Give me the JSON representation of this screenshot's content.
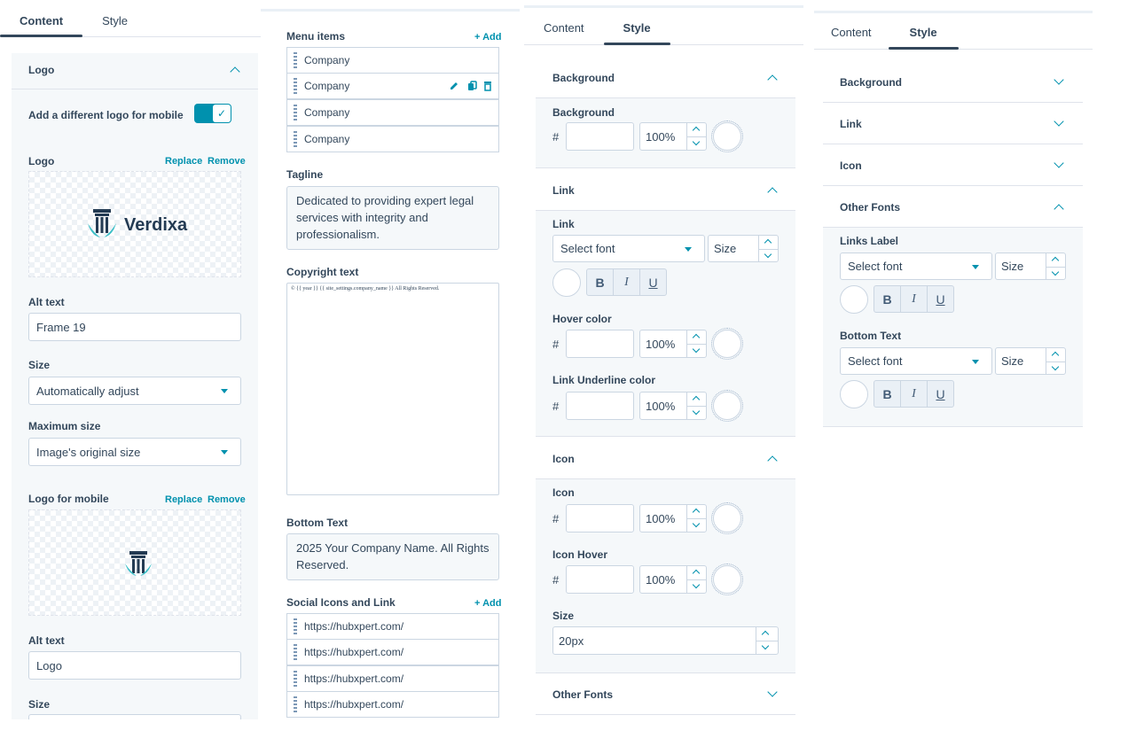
{
  "colors": {
    "accent": "#0091ae",
    "text": "#33475b",
    "border": "#cbd6e2",
    "panel_bg": "#f5f8fa",
    "logo_dark": "#243b53",
    "logo_teal": "#3bbfc7"
  },
  "panel1": {
    "tabs": [
      "Content",
      "Style"
    ],
    "logo_section": "Logo",
    "mobile_toggle_label": "Add a different logo for mobile",
    "logo_label": "Logo",
    "replace": "Replace",
    "remove": "Remove",
    "logo_brand": "Verdixa",
    "alt_text_label": "Alt text",
    "alt_text_value": "Frame 19",
    "size_label": "Size",
    "size_value": "Automatically adjust",
    "max_size_label": "Maximum size",
    "max_size_value": "Image's original size",
    "logo_mobile_label": "Logo for mobile",
    "alt_text2_label": "Alt text",
    "alt_text2_value": "Logo",
    "size2_label": "Size"
  },
  "panel2": {
    "menu_items_label": "Menu items",
    "add": "+ Add",
    "menu_items": [
      "Company",
      "Company",
      "Company",
      "Company"
    ],
    "tagline_label": "Tagline",
    "tagline_value": "Dedicated to providing expert legal services with integrity and professionalism.",
    "copyright_label": "Copyright text",
    "copyright_value": "© {{ year }} {{ site_settings.company_name }} All Rights Reserved.",
    "bottom_text_label": "Bottom Text",
    "bottom_text_value": "2025 Your Company Name. All Rights Reserved.",
    "social_label": "Social Icons and Link",
    "social_links": [
      "https://hubxpert.com/",
      "https://hubxpert.com/",
      "https://hubxpert.com/",
      "https://hubxpert.com/"
    ]
  },
  "panel3": {
    "tabs": [
      "Content",
      "Style"
    ],
    "background_section": "Background",
    "background_label": "Background",
    "hash": "#",
    "pct": "100%",
    "link_section": "Link",
    "link_label": "Link",
    "select_font": "Select font",
    "size_placeholder": "Size",
    "bold": "B",
    "italic": "I",
    "underline": "U",
    "hover_color_label": "Hover color",
    "link_underline_label": "Link Underline color",
    "icon_section": "Icon",
    "icon_label": "Icon",
    "icon_hover_label": "Icon Hover",
    "size_label": "Size",
    "size_value": "20px",
    "other_fonts_section": "Other Fonts"
  },
  "panel4": {
    "tabs": [
      "Content",
      "Style"
    ],
    "sections": [
      "Background",
      "Link",
      "Icon",
      "Other Fonts"
    ],
    "links_label": "Links Label",
    "bottom_text_label": "Bottom Text",
    "select_font": "Select font",
    "size_placeholder": "Size",
    "bold": "B",
    "italic": "I",
    "underline": "U"
  }
}
